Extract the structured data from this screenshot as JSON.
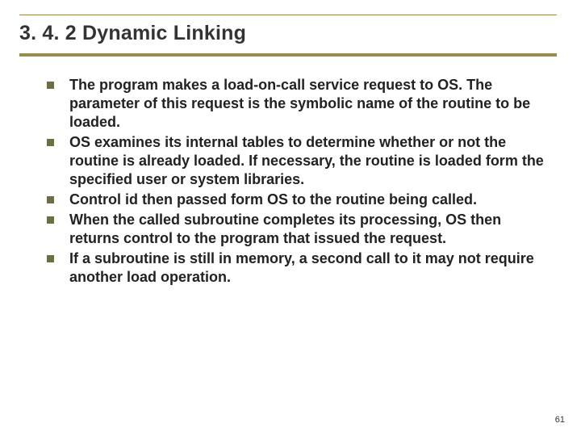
{
  "title": "3. 4. 2 Dynamic Linking",
  "bullets": [
    "The program makes a load-on-call service request to OS. The parameter of this request is the symbolic name of the routine to be loaded.",
    "OS examines its internal tables to determine whether or not the routine is already loaded.  If necessary, the routine is loaded form the specified user or system libraries.",
    "Control id then passed form OS to the routine being called.",
    "When the called subroutine completes its processing, OS then returns control to the program that issued the request.",
    "If a subroutine is still in memory, a second call to it may not require another load operation."
  ],
  "page_number": "61"
}
